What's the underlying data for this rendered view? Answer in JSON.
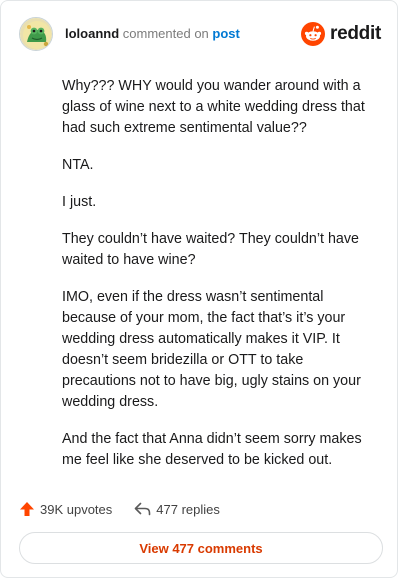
{
  "header": {
    "username": "loloannd",
    "action_text": "commented on",
    "post_link": "post",
    "brand_name": "reddit"
  },
  "comment": {
    "paragraphs": [
      "Why??? WHY would you wander around with a glass of wine next to a white wedding dress that had such extreme sentimental value??",
      "NTA.",
      "I just.",
      "They couldn’t have waited? They couldn’t have waited to have wine?",
      "IMO, even if the dress wasn’t sentimental because of your mom, the fact that’s it’s your wedding dress automatically makes it VIP. It doesn’t seem bridezilla or OTT to take precautions not to have big, ugly stains on your wedding dress.",
      "And the fact that Anna didn’t seem sorry makes me feel like she deserved to be kicked out."
    ]
  },
  "footer": {
    "upvotes": "39K upvotes",
    "replies": "477 replies",
    "view_button": "View 477 comments"
  },
  "icons": {
    "avatar": "frog-avatar",
    "brand": "reddit-logo-icon",
    "upvote": "upvote-arrow-icon",
    "reply": "reply-arrow-icon"
  },
  "colors": {
    "brand_orange": "#ff4500",
    "link_blue": "#0079d3",
    "button_text": "#d93a00",
    "text": "#1a1a1b"
  }
}
